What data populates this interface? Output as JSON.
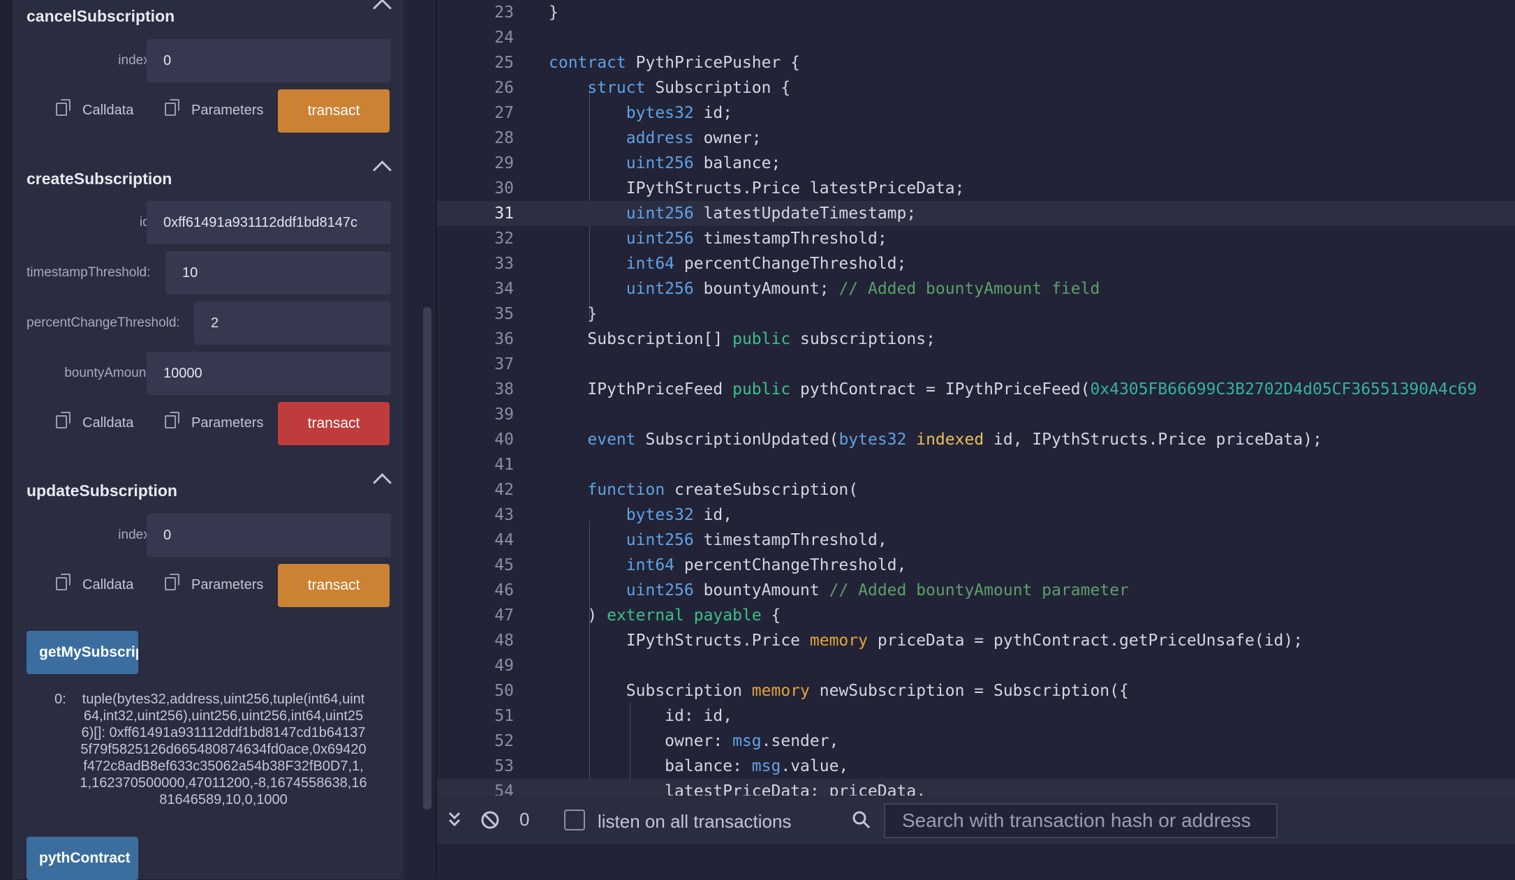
{
  "left_panel": {
    "cancel": {
      "title": "cancelSubscription",
      "index_label": "index:",
      "index_value": "0",
      "calldata_label": "Calldata",
      "parameters_label": "Parameters",
      "transact_label": "transact"
    },
    "create": {
      "title": "createSubscription",
      "id_label": "id:",
      "id_value": "0xff61491a931112ddf1bd8147c",
      "ts_label": "timestampThreshold:",
      "ts_value": "10",
      "pct_label": "percentChangeThreshold:",
      "pct_value": "2",
      "bounty_label": "bountyAmount:",
      "bounty_value": "10000",
      "calldata_label": "Calldata",
      "parameters_label": "Parameters",
      "transact_label": "transact"
    },
    "update": {
      "title": "updateSubscription",
      "index_label": "index:",
      "index_value": "0",
      "calldata_label": "Calldata",
      "parameters_label": "Parameters",
      "transact_label": "transact"
    },
    "get_button": "getMySubscriptions",
    "result_index": "0:",
    "result_text": "tuple(bytes32,address,uint256,tuple(int64,uint64,int32,uint256),uint256,uint256,int64,uint256)[]: 0xff61491a931112ddf1bd8147cd1b641375f79f5825126d665480874634fd0ace,0x69420f472c8adB8ef633c35062a54b38F32fB0D7,1,1,162370500000,47011200,-8,1674558638,1681646589,10,0,1000",
    "pyth_button": "pythContract"
  },
  "editor": {
    "lines": [
      {
        "n": "23",
        "html": "}"
      },
      {
        "n": "24",
        "html": ""
      },
      {
        "n": "25",
        "html": "<span class='kw'>contract</span> PythPricePusher {"
      },
      {
        "n": "26",
        "html": "    <span class='kw'>struct</span> Subscription {"
      },
      {
        "n": "27",
        "html": "        <span class='ty'>bytes32</span> id;"
      },
      {
        "n": "28",
        "html": "        <span class='ty'>address</span> owner;"
      },
      {
        "n": "29",
        "html": "        <span class='ty'>uint256</span> balance;"
      },
      {
        "n": "30",
        "html": "        IPythStructs.Price latestPriceData;"
      },
      {
        "n": "31",
        "html": "        <span class='ty'>uint256</span> latestUpdateTimestamp;",
        "hl": true
      },
      {
        "n": "32",
        "html": "        <span class='ty'>uint256</span> timestampThreshold;"
      },
      {
        "n": "33",
        "html": "        <span class='ty'>int64</span> percentChangeThreshold;"
      },
      {
        "n": "34",
        "html": "        <span class='ty'>uint256</span> bountyAmount; <span class='cm'>// Added bountyAmount field</span>"
      },
      {
        "n": "35",
        "html": "    }"
      },
      {
        "n": "36",
        "html": "    Subscription[] <span class='gr'>public</span> subscriptions;"
      },
      {
        "n": "37",
        "html": ""
      },
      {
        "n": "38",
        "html": "    IPythPriceFeed <span class='gr'>public</span> pythContract = IPythPriceFeed(<span class='hex'>0x4305FB66699C3B2702D4d05CF36551390A4c69</span>"
      },
      {
        "n": "39",
        "html": ""
      },
      {
        "n": "40",
        "html": "    <span class='kw'>event</span> SubscriptionUpdated(<span class='ty'>bytes32</span> <span class='ye'>indexed</span> id, IPythStructs.Price priceData);"
      },
      {
        "n": "41",
        "html": ""
      },
      {
        "n": "42",
        "html": "    <span class='kw'>function</span> createSubscription("
      },
      {
        "n": "43",
        "html": "        <span class='ty'>bytes32</span> id,"
      },
      {
        "n": "44",
        "html": "        <span class='ty'>uint256</span> timestampThreshold,"
      },
      {
        "n": "45",
        "html": "        <span class='ty'>int64</span> percentChangeThreshold,"
      },
      {
        "n": "46",
        "html": "        <span class='ty'>uint256</span> bountyAmount <span class='cm'>// Added bountyAmount parameter</span>"
      },
      {
        "n": "47",
        "html": "    ) <span class='gr'>external</span> <span class='gr'>payable</span> {"
      },
      {
        "n": "48",
        "html": "        IPythStructs.Price <span class='or'>memory</span> priceData = pythContract.getPriceUnsafe(id);"
      },
      {
        "n": "49",
        "html": ""
      },
      {
        "n": "50",
        "html": "        Subscription <span class='or'>memory</span> newSubscription = Subscription({"
      },
      {
        "n": "51",
        "html": "            id: id,"
      },
      {
        "n": "52",
        "html": "            owner: <span class='kw'>msg</span>.sender,"
      },
      {
        "n": "53",
        "html": "            balance: <span class='kw'>msg</span>.value,"
      },
      {
        "n": "54",
        "html": "            latestPriceData: priceData,",
        "hl": true
      }
    ]
  },
  "terminal": {
    "count": "0",
    "listen_label": "listen on all transactions",
    "search_placeholder": "Search with transaction hash or address"
  }
}
